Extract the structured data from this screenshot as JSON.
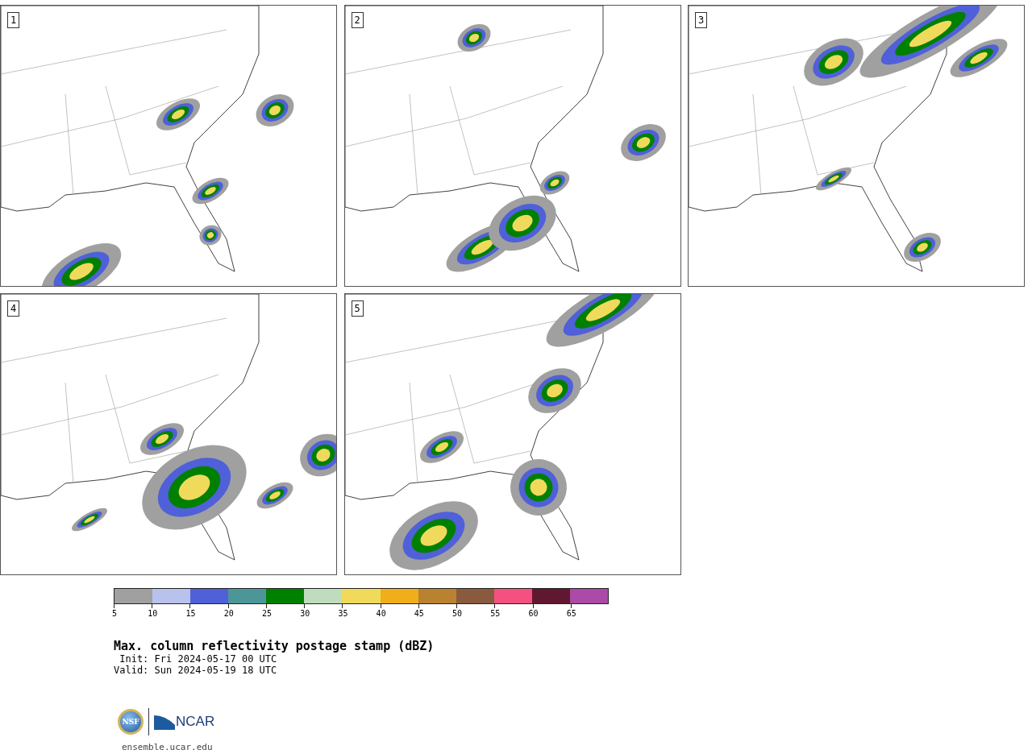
{
  "panels": [
    {
      "label": "1"
    },
    {
      "label": "2"
    },
    {
      "label": "3"
    },
    {
      "label": "4"
    },
    {
      "label": "5"
    }
  ],
  "colorbar": [
    {
      "tick": "5",
      "color": "#a0a0a0"
    },
    {
      "tick": "10",
      "color": "#b8c2ec"
    },
    {
      "tick": "15",
      "color": "#5060d8"
    },
    {
      "tick": "20",
      "color": "#4c9698"
    },
    {
      "tick": "25",
      "color": "#008000"
    },
    {
      "tick": "30",
      "color": "#bfddbd"
    },
    {
      "tick": "35",
      "color": "#f0da5c"
    },
    {
      "tick": "40",
      "color": "#f0ae1a"
    },
    {
      "tick": "45",
      "color": "#b88230"
    },
    {
      "tick": "50",
      "color": "#8a5a3e"
    },
    {
      "tick": "55",
      "color": "#f45080"
    },
    {
      "tick": "60",
      "color": "#601830"
    },
    {
      "tick": "65",
      "color": "#ac4aa8"
    }
  ],
  "title": "Max. column reflectivity postage stamp (dBZ)",
  "init": " Init: Fri 2024-05-17 00 UTC",
  "valid": "Valid: Sun 2024-05-19 18 UTC",
  "logo": {
    "seal": "NSF",
    "wordmark": "NCAR"
  },
  "footer": "ensemble.ucar.edu"
}
